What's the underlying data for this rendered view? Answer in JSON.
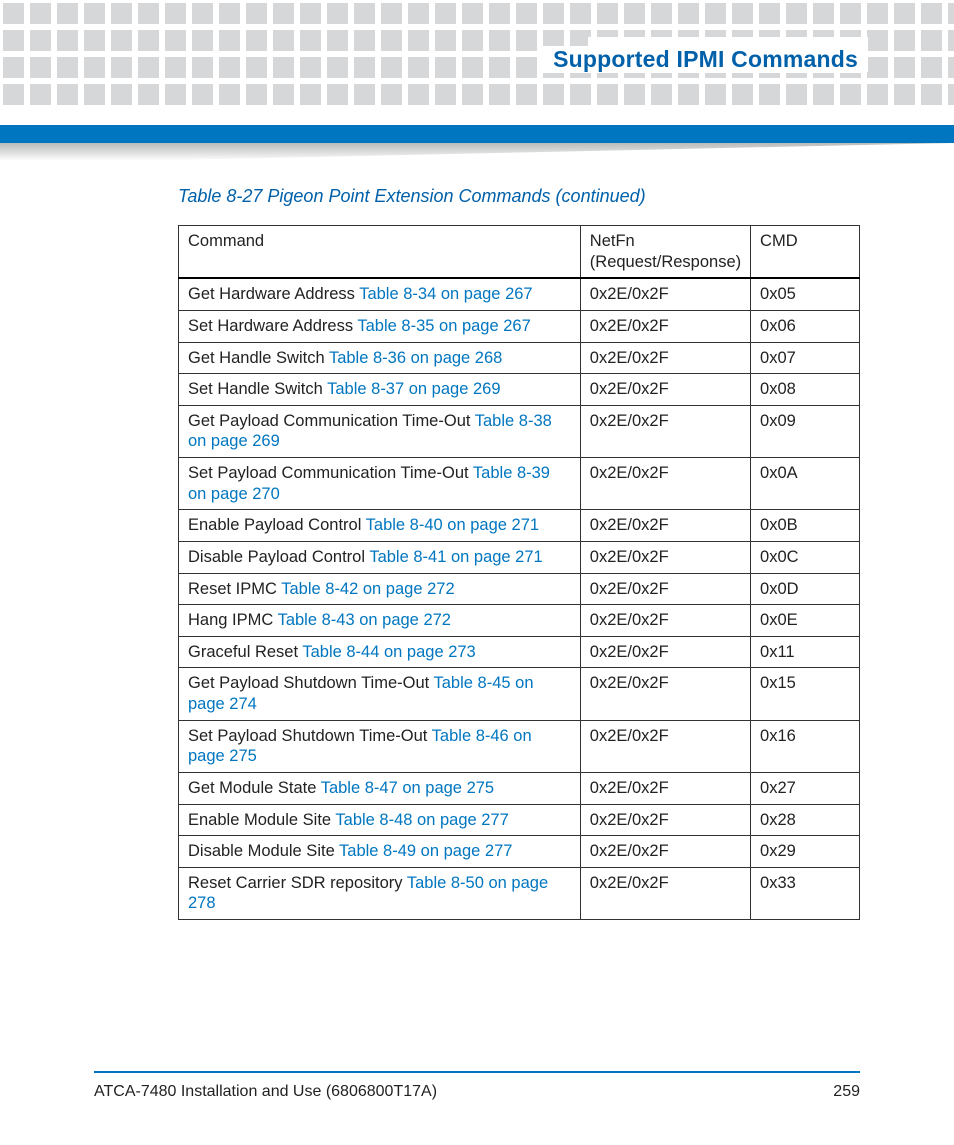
{
  "header": {
    "title": "Supported IPMI Commands"
  },
  "table": {
    "caption": "Table 8-27 Pigeon Point Extension Commands (continued)",
    "headers": {
      "c1": "Command",
      "c2": "NetFn (Request/Response)",
      "c3": "CMD"
    },
    "rows": [
      {
        "cmd_text": "Get Hardware Address ",
        "cmd_link": "Table 8-34 on page 267",
        "netfn": "0x2E/0x2F",
        "cmd": "0x05"
      },
      {
        "cmd_text": "Set Hardware Address ",
        "cmd_link": "Table 8-35 on page 267",
        "netfn": "0x2E/0x2F",
        "cmd": "0x06"
      },
      {
        "cmd_text": "Get Handle Switch ",
        "cmd_link": "Table 8-36 on page 268",
        "netfn": "0x2E/0x2F",
        "cmd": "0x07"
      },
      {
        "cmd_text": "Set Handle Switch ",
        "cmd_link": "Table 8-37 on page 269",
        "netfn": "0x2E/0x2F",
        "cmd": "0x08"
      },
      {
        "cmd_text": "Get Payload Communication Time-Out ",
        "cmd_link": "Table 8-38 on page 269",
        "netfn": "0x2E/0x2F",
        "cmd": "0x09"
      },
      {
        "cmd_text": "Set Payload Communication Time-Out ",
        "cmd_link": "Table 8-39 on page 270",
        "netfn": "0x2E/0x2F",
        "cmd": "0x0A"
      },
      {
        "cmd_text": "Enable Payload Control ",
        "cmd_link": "Table 8-40 on page 271",
        "netfn": "0x2E/0x2F",
        "cmd": "0x0B"
      },
      {
        "cmd_text": "Disable Payload Control ",
        "cmd_link": "Table 8-41 on page 271",
        "netfn": "0x2E/0x2F",
        "cmd": "0x0C"
      },
      {
        "cmd_text": "Reset IPMC ",
        "cmd_link": "Table 8-42 on page 272",
        "netfn": "0x2E/0x2F",
        "cmd": "0x0D"
      },
      {
        "cmd_text": "Hang IPMC ",
        "cmd_link": "Table 8-43 on page 272",
        "netfn": "0x2E/0x2F",
        "cmd": "0x0E"
      },
      {
        "cmd_text": "Graceful Reset ",
        "cmd_link": "Table 8-44 on page 273",
        "netfn": "0x2E/0x2F",
        "cmd": "0x11"
      },
      {
        "cmd_text": "Get Payload Shutdown Time-Out ",
        "cmd_link": "Table 8-45 on page 274",
        "netfn": "0x2E/0x2F",
        "cmd": "0x15"
      },
      {
        "cmd_text": "Set Payload Shutdown Time-Out ",
        "cmd_link": "Table 8-46 on page 275",
        "netfn": "0x2E/0x2F",
        "cmd": "0x16"
      },
      {
        "cmd_text": "Get Module State ",
        "cmd_link": "Table 8-47 on page 275",
        "netfn": "0x2E/0x2F",
        "cmd": "0x27"
      },
      {
        "cmd_text": "Enable Module Site ",
        "cmd_link": "Table 8-48 on page 277",
        "netfn": "0x2E/0x2F",
        "cmd": "0x28"
      },
      {
        "cmd_text": "Disable Module Site ",
        "cmd_link": "Table 8-49 on page 277",
        "netfn": "0x2E/0x2F",
        "cmd": "0x29"
      },
      {
        "cmd_text": "Reset Carrier SDR repository ",
        "cmd_link": "Table 8-50 on page 278",
        "netfn": "0x2E/0x2F",
        "cmd": "0x33"
      }
    ]
  },
  "footer": {
    "doc": "ATCA-7480 Installation and Use (6806800T17A)",
    "page": "259"
  }
}
